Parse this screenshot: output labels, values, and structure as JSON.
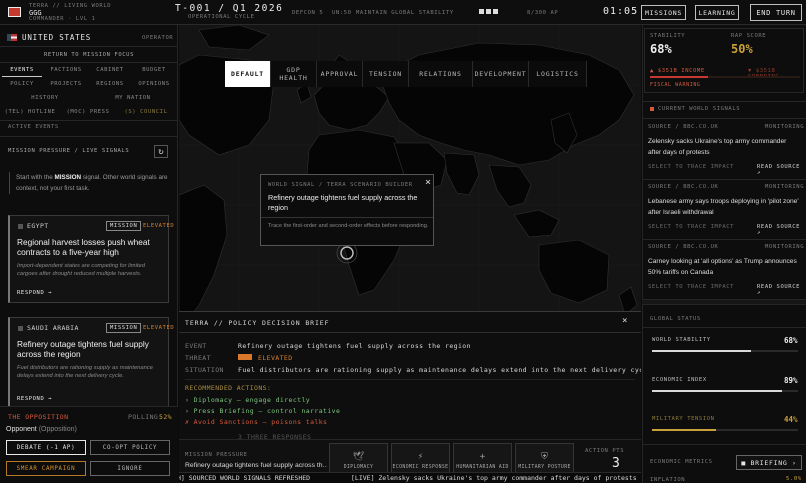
{
  "topbar": {
    "game_name": "TERRA // LIVING WORLD",
    "player": "GGG",
    "role": "COMMANDER · LVL 1",
    "turn": "T-001 / Q1 2026",
    "cycle": "OPERATIONAL CYCLE",
    "defcon": "DEFCON 5",
    "un": "UN:50",
    "directive": "MAINTAIN GLOBAL STABILITY",
    "budget": "8/300 AP",
    "clock": "01:05",
    "missions_label": "MISSIONS",
    "learning_label": "LEARNING",
    "end_turn_label": "END TURN"
  },
  "left": {
    "country": "UNITED STATES",
    "country_role": "OPERATOR",
    "return_label": "RETURN TO MISSION FOCUS",
    "nav_rows": [
      [
        "EVENTS",
        "FACTIONS",
        "CABINET",
        "BUDGET"
      ],
      [
        "POLICY",
        "PROJECTS",
        "REGIONS",
        "OPINIONS"
      ],
      [
        "HISTORY",
        "MY NATION"
      ],
      [
        "(TEL) HOTLINE",
        "(MOC) PRESS",
        "(S) COUNCIL"
      ]
    ],
    "active_events": "ACTIVE EVENTS",
    "mission_pressure_title": "MISSION PRESSURE / LIVE SIGNALS",
    "intro_pre": "Start with the ",
    "intro_key": "MISSION",
    "intro_post": " signal. Other world signals are context, not your first task.",
    "cards": [
      {
        "country": "EGYPT",
        "badge": "MISSION",
        "status": "ELEVATED",
        "title": "Regional harvest losses push wheat contracts to a five-year high",
        "body": "Import-dependent states are competing for limited cargoes after drought reduced multiple harvests.",
        "respond": "RESPOND →"
      },
      {
        "country": "SAUDI ARABIA",
        "badge": "MISSION",
        "status": "ELEVATED",
        "title": "Refinery outage tightens fuel supply across the region",
        "body": "Fuel distributors are rationing supply as maintenance delays extend into the next delivery cycle.",
        "respond": "RESPOND →"
      }
    ],
    "opposition": {
      "title": "THE OPPOSITION",
      "polling_label": "POLLING:",
      "polling_value": "52%",
      "opponent": "Opponent",
      "opponent_note": "(Opposition)",
      "buttons": [
        "DEBATE (-1 AP)",
        "CO-OPT POLICY",
        "SMEAR CAMPAIGN",
        "IGNORE"
      ]
    }
  },
  "map": {
    "tabs": [
      "DEFAULT",
      "GDP HEALTH",
      "APPROVAL",
      "TENSION",
      "RELATIONS",
      "DEVELOPMENT",
      "LOGISTICS"
    ],
    "active_tab": "DEFAULT",
    "popup": {
      "header": "WORLD SIGNAL / TERRA SCENARIO BUILDER",
      "title": "Refinery outage tightens fuel supply across the region",
      "body": "Trace the first-order and second-order effects before responding.",
      "close": "×"
    }
  },
  "brief": {
    "header": "TERRA // POLICY DECISION BRIEF",
    "close": "×",
    "event_label": "EVENT",
    "event_value": "Refinery outage tightens fuel supply across the region",
    "threat_label": "THREAT",
    "threat_value": "ELEVATED",
    "situation_label": "SITUATION",
    "situation_value": "Fuel distributors are rationing supply as maintenance delays extend into the next delivery cycle.",
    "actions_label": "RECOMMENDED ACTIONS:",
    "actions": [
      "Diplomacy — engage directly",
      "Press Briefing — control narrative",
      "Avoid Sanctions — poisons talks"
    ],
    "truncated": "3 THREE RESPONSES",
    "mission_label": "MISSION PRESSURE",
    "mission_value": "Refinery outage tightens fuel supply across th…",
    "options": [
      "DIPLOMACY",
      "ECONOMIC RESPONSE",
      "HUMANITARIAN AID",
      "MILITARY POSTURE"
    ],
    "action_pts_label": "ACTION PTS",
    "action_pts_value": "3"
  },
  "right": {
    "stability_label": "STABILITY",
    "stability_value": "68%",
    "approval_label": "RAP SCORE",
    "approval_value": "50%",
    "income": "▲ $351B INCOME",
    "spending": "▼ $351B SPENDING",
    "fiscal": "FISCAL WARNING",
    "signals_title": "CURRENT WORLD SIGNALS",
    "signals": [
      {
        "source": "SOURCE / BBC.CO.UK",
        "tag": "MONITORING",
        "text": "Zelensky sacks Ukraine's top army commander after days of protests",
        "trace": "SELECT TO TRACE IMPACT",
        "read": "READ SOURCE ↗"
      },
      {
        "source": "SOURCE / BBC.CO.UK",
        "tag": "MONITORING",
        "text": "Lebanese army says troops deploying in 'pilot zone' after Israeli withdrawal",
        "trace": "SELECT TO TRACE IMPACT",
        "read": "READ SOURCE ↗"
      },
      {
        "source": "SOURCE / BBC.CO.UK",
        "tag": "MONITORING",
        "text": "Carney looking at 'all options' as Trump announces 50% tariffs on Canada",
        "trace": "SELECT TO TRACE IMPACT",
        "read": "READ SOURCE ↗"
      }
    ],
    "global_status_title": "GLOBAL STATUS",
    "status": [
      {
        "label": "WORLD STABILITY",
        "value": "68%",
        "level": 0.68,
        "color": "#d9d9d9"
      },
      {
        "label": "ECONOMIC INDEX",
        "value": "89%",
        "level": 0.89,
        "color": "#d9d9d9"
      },
      {
        "label": "MILITARY TENSION",
        "value": "44%",
        "level": 0.44,
        "color": "#c9a13a"
      }
    ],
    "econ_title": "ECONOMIC METRICS",
    "briefing_label": "■ BRIEFING ›",
    "inflation_label": "INFLATION",
    "inflation_value": "5.0%"
  },
  "ticker": {
    "left": "H] SOURCED WORLD SIGNALS REFRESHED",
    "right": "[LIVE] Zelensky sacks Ukraine's top army commander after days of protests"
  }
}
